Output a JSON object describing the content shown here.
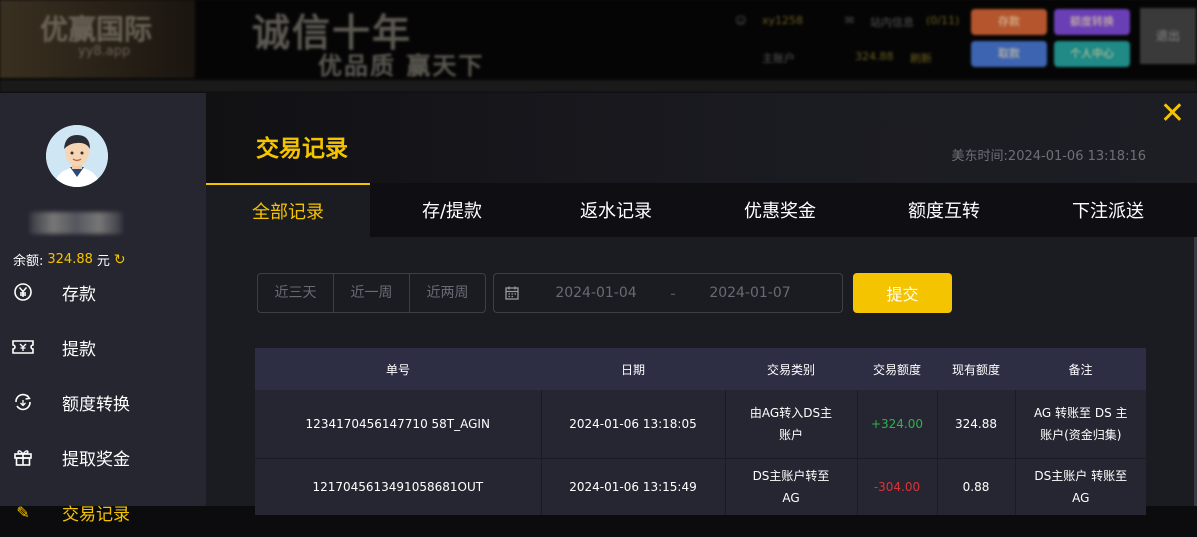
{
  "background": {
    "logo": "优赢国际",
    "logo_sub": "yy8.app",
    "slogan_main": "诚信十年",
    "slogan_sub": "优品质  赢天下",
    "user": "xy1258",
    "balance_label": "主账户",
    "balance": "324.88",
    "messages": "站内信息",
    "message_count": "(0/11)",
    "buttons": [
      "存款",
      "额度转换",
      "取款",
      "个人中心"
    ],
    "logout": "退出"
  },
  "sidebar": {
    "balance_label": "余额:",
    "balance_value": "324.88",
    "balance_unit": "元",
    "items": [
      {
        "label": "存款",
        "icon": "yen-coin-icon"
      },
      {
        "label": "提款",
        "icon": "ticket-icon"
      },
      {
        "label": "额度转换",
        "icon": "exchange-icon"
      },
      {
        "label": "提取奖金",
        "icon": "gift-icon"
      },
      {
        "label": "交易记录",
        "icon": "record-icon"
      }
    ]
  },
  "header": {
    "title": "交易记录",
    "time_label": "美东时间:",
    "time_value": "2024-01-06 13:18:16"
  },
  "tabs": [
    "全部记录",
    "存/提款",
    "返水记录",
    "优惠奖金",
    "额度互转",
    "下注派送"
  ],
  "active_tab": 0,
  "filters": {
    "ranges": [
      "近三天",
      "近一周",
      "近两周"
    ],
    "date_start": "2024-01-04",
    "date_separator": "-",
    "date_end": "2024-01-07",
    "submit": "提交"
  },
  "table": {
    "columns": [
      "单号",
      "日期",
      "交易类别",
      "交易额度",
      "现有额度",
      "备注"
    ],
    "rows": [
      {
        "id": "1234170456147710 58T_AGIN",
        "date": "2024-01-06 13:18:05",
        "type": "由AG转入DS主账户",
        "amount": "+324.00",
        "balance": "324.88",
        "note": "AG 转账至 DS 主账户(资金归集)"
      },
      {
        "id": "1217045613491058681OUT",
        "date": "2024-01-06 13:15:49",
        "type": "DS主账户转至AG",
        "amount": "-304.00",
        "balance": "0.88",
        "note": "DS主账户 转账至 AG"
      }
    ]
  },
  "colors": {
    "accent": "#f5c400",
    "positive": "#2fb34a",
    "negative": "#d8343b"
  }
}
